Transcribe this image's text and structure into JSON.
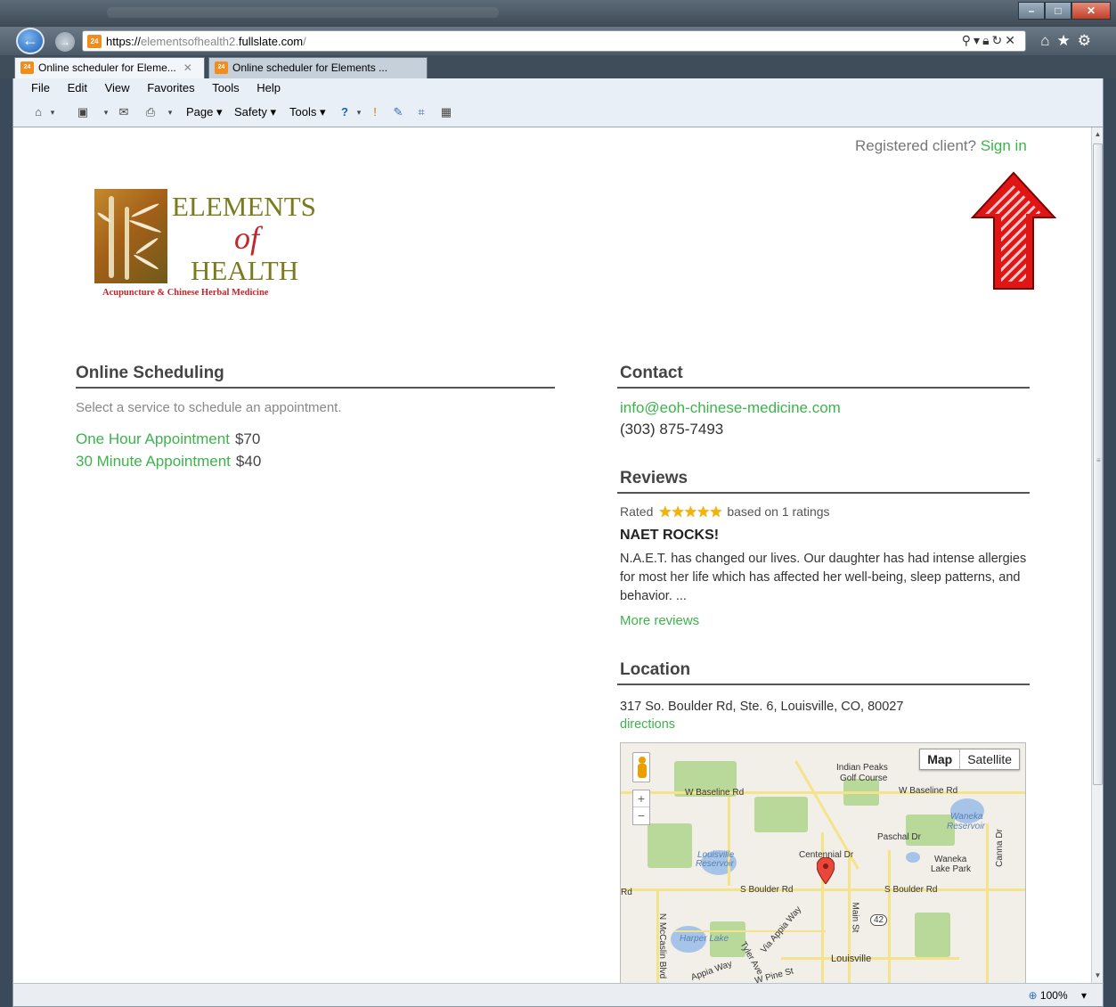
{
  "browser": {
    "url_scheme": "https://",
    "url_sub": "elementsofhealth2.",
    "url_domain": "fullslate.com",
    "url_path": "/",
    "tabs": [
      {
        "label": "Online scheduler for Eleme...",
        "close": "✕"
      },
      {
        "label": "Online scheduler for Elements ..."
      }
    ],
    "menu": [
      "File",
      "Edit",
      "View",
      "Favorites",
      "Tools",
      "Help"
    ],
    "commands": {
      "page": "Page ▾",
      "safety": "Safety ▾",
      "tools": "Tools ▾"
    },
    "zoom": "100%",
    "favicon_text": "24"
  },
  "page": {
    "signin_prompt": "Registered client?",
    "signin_link": "Sign in",
    "logo": {
      "line1": "ELEMENTS",
      "line2": "of",
      "line3": "HEALTH",
      "tagline": "Acupuncture & Chinese Herbal Medicine"
    },
    "scheduling": {
      "heading": "Online Scheduling",
      "subtitle": "Select a service to schedule an appointment.",
      "services": [
        {
          "name": "One Hour Appointment",
          "price": "$70"
        },
        {
          "name": "30 Minute Appointment",
          "price": "$40"
        }
      ]
    },
    "contact": {
      "heading": "Contact",
      "email": "info@eoh-chinese-medicine.com",
      "phone": "(303) 875-7493"
    },
    "reviews": {
      "heading": "Reviews",
      "rated_prefix": "Rated",
      "stars": "★★★★★",
      "rated_suffix": "based on 1 ratings",
      "title": "NAET ROCKS!",
      "body": "N.A.E.T. has changed our lives. Our daughter has had intense allergies for most her life which has affected her well-being, sleep patterns, and behavior. ...",
      "more": "More reviews"
    },
    "location": {
      "heading": "Location",
      "address": "317 So. Boulder Rd, Ste. 6, Louisville, CO, 80027",
      "directions": "directions",
      "map": {
        "type_map": "Map",
        "type_satellite": "Satellite",
        "zoom_in": "+",
        "zoom_out": "−",
        "labels": {
          "indian_peaks": "Indian Peaks",
          "golf_course": "Golf Course",
          "w_baseline_left": "W Baseline Rd",
          "w_baseline_right": "W Baseline Rd",
          "waneka_res": "Waneka",
          "waneka_res2": "Reservoir",
          "paschal": "Paschal Dr",
          "canna": "Canna Dr",
          "louisville_res": "Louisville",
          "louisville_res2": "Reservoir",
          "centennial": "Centennial Dr",
          "waneka_lake": "Waneka",
          "waneka_lake2": "Lake Park",
          "s_boulder_left": "S Boulder Rd",
          "s_boulder_right": "S Boulder Rd",
          "rd_edge": "Rd",
          "main_st": "Main St",
          "route": "42",
          "mccaslin": "N McCaslin Blvd",
          "harper_lake": "Harper Lake",
          "via_appia": "Via Appia Way",
          "tyler": "Tyler Ave",
          "appia_way": "Appia Way",
          "pine": "W Pine St",
          "louisville": "Louisville"
        }
      }
    }
  }
}
